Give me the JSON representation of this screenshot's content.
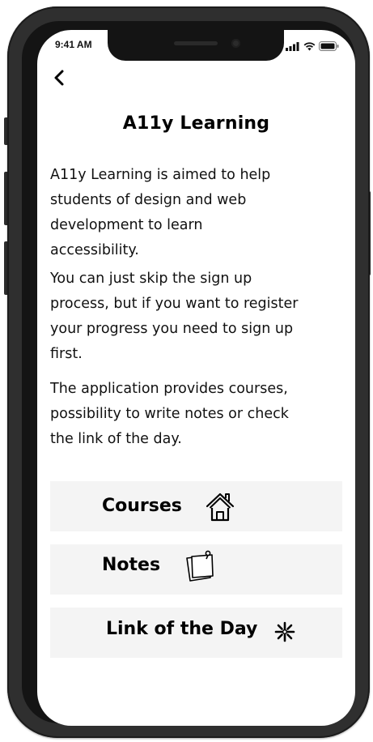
{
  "status_bar": {
    "time": "9:41 AM",
    "icons": [
      "signal-icon",
      "wifi-icon",
      "battery-icon"
    ]
  },
  "header": {
    "back_icon": "chevron-left-icon",
    "title": "A11y Learning"
  },
  "content": {
    "paragraphs": [
      {
        "lines": [
          "A11y Learning is aimed to help",
          "students of design and web",
          "development to learn",
          "accessibility."
        ]
      },
      {
        "lines": [
          "You can just skip the sign up",
          "process, but if you want to register",
          "your progress you need to sign up",
          "first."
        ]
      },
      {
        "lines": [
          "The application provides courses,",
          "possibility to write notes or check",
          "the link of the day."
        ]
      }
    ]
  },
  "menu": {
    "items": [
      {
        "label": "Courses",
        "icon": "house-icon"
      },
      {
        "label": "Notes",
        "icon": "sticky-note-icon"
      },
      {
        "label": "Link of the Day",
        "icon": "sparkle-icon"
      }
    ]
  },
  "colors": {
    "frame": "#2f2f2f",
    "card_background": "#f4f4f4",
    "text": "#111111"
  }
}
